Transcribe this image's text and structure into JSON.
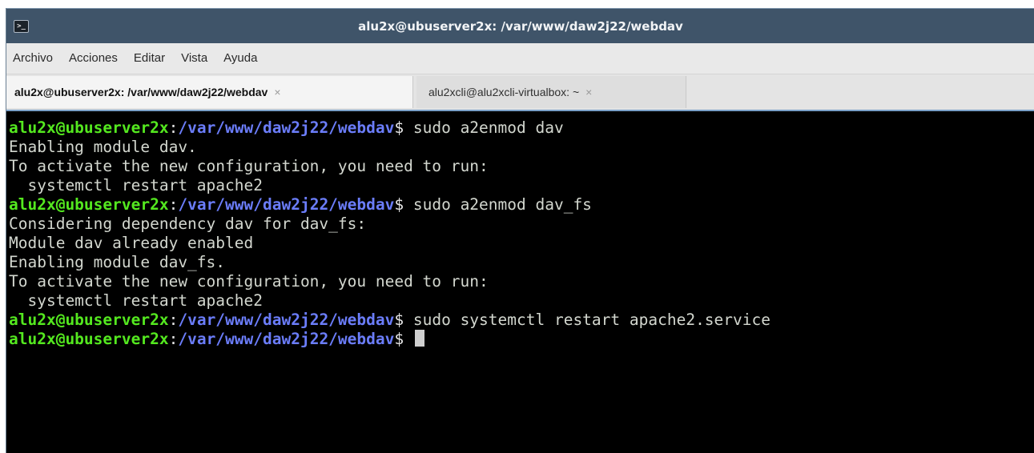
{
  "window": {
    "title": "alu2x@ubuserver2x: /var/www/daw2j22/webdav",
    "icon": "terminal-icon",
    "icon_glyph": ">_"
  },
  "menubar": {
    "items": [
      "Archivo",
      "Acciones",
      "Editar",
      "Vista",
      "Ayuda"
    ]
  },
  "tabs": [
    {
      "label": "alu2x@ubuserver2x: /var/www/daw2j22/webdav",
      "active": true,
      "close": "×"
    },
    {
      "label": "alu2xcli@alu2xcli-virtualbox: ~",
      "active": false,
      "close": "×"
    }
  ],
  "prompt": {
    "user_host": "alu2x@ubuserver2x",
    "colon": ":",
    "path": "/var/www/daw2j22/webdav",
    "dollar": "$"
  },
  "lines": [
    {
      "type": "prompt",
      "command": " sudo a2enmod dav"
    },
    {
      "type": "output",
      "text": "Enabling module dav."
    },
    {
      "type": "output",
      "text": "To activate the new configuration, you need to run:"
    },
    {
      "type": "output",
      "text": "  systemctl restart apache2"
    },
    {
      "type": "prompt",
      "command": " sudo a2enmod dav_fs"
    },
    {
      "type": "output",
      "text": "Considering dependency dav for dav_fs:"
    },
    {
      "type": "output",
      "text": "Module dav already enabled"
    },
    {
      "type": "output",
      "text": "Enabling module dav_fs."
    },
    {
      "type": "output",
      "text": "To activate the new configuration, you need to run:"
    },
    {
      "type": "output",
      "text": "  systemctl restart apache2"
    },
    {
      "type": "prompt",
      "command": " sudo systemctl restart apache2.service"
    },
    {
      "type": "prompt",
      "command": " ",
      "cursor": true
    }
  ],
  "colors": {
    "user_host": "#54e81f",
    "path": "#6b7dfa",
    "output": "#d3d7cf",
    "terminal_bg": "#000000",
    "titlebar_bg": "#3f5469"
  }
}
